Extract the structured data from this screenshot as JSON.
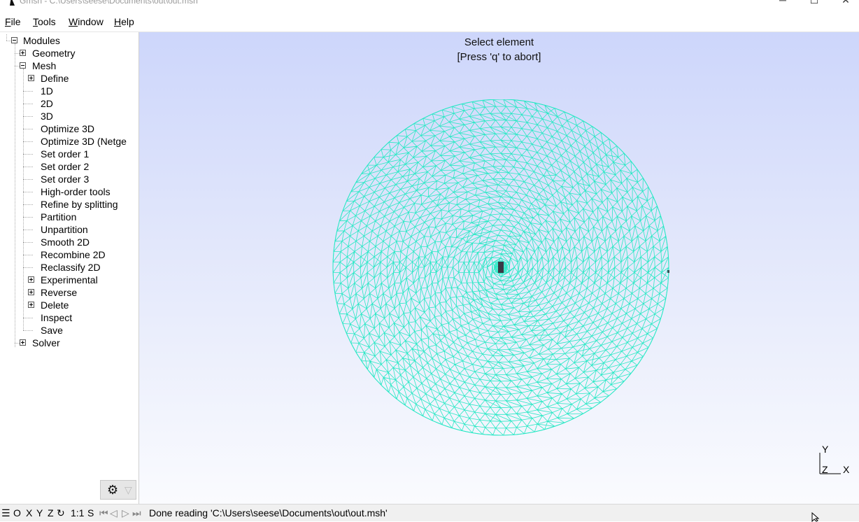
{
  "window": {
    "title": "Gmsh - C:\\Users\\seese\\Documents\\out\\out.msh",
    "minimize_glyph": "─",
    "maximize_glyph": "☐",
    "close_glyph": "✕"
  },
  "menu": [
    {
      "label": "File",
      "accel": "F",
      "rest": "ile"
    },
    {
      "label": "Tools",
      "accel": "T",
      "rest": "ools"
    },
    {
      "label": "Window",
      "accel": "W",
      "rest": "indow"
    },
    {
      "label": "Help",
      "accel": "H",
      "rest": "elp"
    }
  ],
  "tree": {
    "modules": "Modules",
    "geometry": "Geometry",
    "mesh": "Mesh",
    "mesh_items": [
      "Define",
      "1D",
      "2D",
      "3D",
      "Optimize 3D",
      "Optimize 3D (Netge",
      "Set order 1",
      "Set order 2",
      "Set order 3",
      "High-order tools",
      "Refine by splitting",
      "Partition",
      "Unpartition",
      "Smooth 2D",
      "Recombine 2D",
      "Reclassify 2D",
      "Experimental",
      "Reverse",
      "Delete",
      "Inspect",
      "Save"
    ],
    "solver": "Solver"
  },
  "graphics": {
    "prompt_line1": "Select element",
    "prompt_line2": "[Press 'q' to abort]",
    "mesh_color": "#27e8c4",
    "axis_y": "Y",
    "axis_z": "Z",
    "axis_x": "X"
  },
  "status": {
    "menu_glyph": "☰",
    "view_o": "O",
    "view_x": "X",
    "view_y": "Y",
    "view_z": "Z",
    "rotate_glyph": "↻",
    "scale": "1:1",
    "select_s": "S",
    "nav_first": "⏮",
    "nav_prev": "◁",
    "nav_next": "▷",
    "nav_last": "⏭",
    "message": "Done reading 'C:\\Users\\seese\\Documents\\out\\out.msh'"
  },
  "settings": {
    "gear_glyph": "⚙",
    "filter_glyph": "▽"
  }
}
